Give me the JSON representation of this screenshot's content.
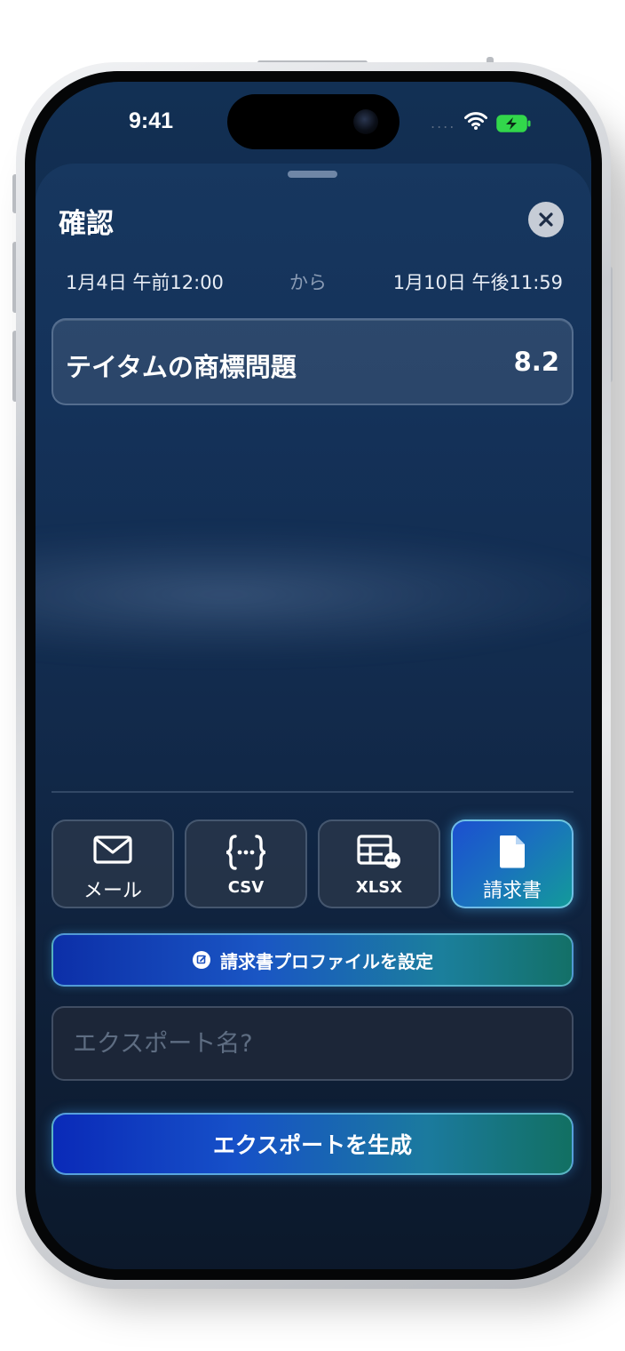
{
  "status_bar": {
    "time": "9:41",
    "signal_dots": "....",
    "battery_color": "#32d74b"
  },
  "sheet": {
    "title": "確認",
    "close_icon": "close-icon"
  },
  "date_range": {
    "start": "1月4日 午前12:00",
    "separator": "から",
    "end": "1月10日 午後11:59"
  },
  "items": [
    {
      "name": "テイタムの商標問題",
      "value": "8.2"
    }
  ],
  "export_options": [
    {
      "label": "メール",
      "icon": "envelope-icon",
      "selected": false
    },
    {
      "label": "CSV",
      "icon": "braces-icon",
      "selected": false
    },
    {
      "label": "XLSX",
      "icon": "spreadsheet-icon",
      "selected": false
    },
    {
      "label": "請求書",
      "icon": "document-icon",
      "selected": true
    }
  ],
  "invoice_profile_button": {
    "label": "請求書プロファイルを設定",
    "icon": "edit-icon"
  },
  "export_name_input": {
    "value": "",
    "placeholder": "エクスポート名?"
  },
  "generate_button": {
    "label": "エクスポートを生成"
  },
  "colors": {
    "accent_start": "#0a2ab8",
    "accent_end": "#127062",
    "sheet_bg": "#14325a"
  }
}
